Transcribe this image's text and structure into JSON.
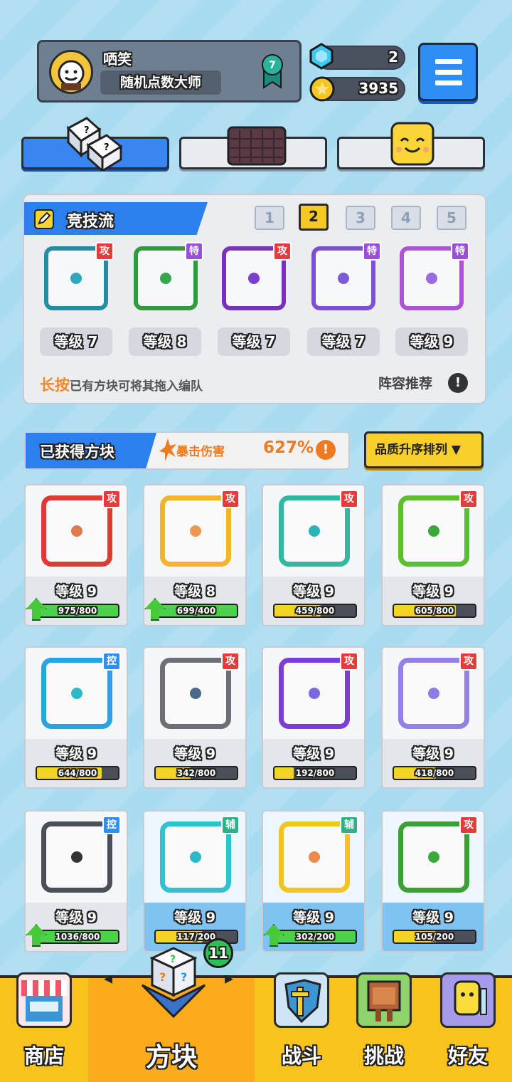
{
  "profile": {
    "nickname": "哂笑",
    "title": "随机点数大师",
    "rank": "7"
  },
  "currency": {
    "gems": "2",
    "coins": "3935"
  },
  "deck": {
    "title": "竞技流",
    "pages": [
      "1",
      "2",
      "3",
      "4",
      "5"
    ],
    "active_page": "2",
    "slots": [
      {
        "tag": "攻",
        "level": "等级 7",
        "color": "#1f8ea6",
        "dot": "#2da6be"
      },
      {
        "tag": "特",
        "level": "等级 8",
        "color": "#2e9b3d",
        "dot": "#34a84a"
      },
      {
        "tag": "攻",
        "level": "等级 7",
        "color": "#7b2fbf",
        "dot": "#7b3ed3"
      },
      {
        "tag": "特",
        "level": "等级 7",
        "color": "#7c4fd6",
        "dot": "#7a5cd6"
      },
      {
        "tag": "特",
        "level": "等级 9",
        "color": "#b04fd9",
        "dot": "#9a6be0"
      }
    ],
    "hint_highlight": "长按",
    "hint_text": "已有方块可将其拖入编队",
    "recommend": "阵容推荐"
  },
  "owned": {
    "label": "已获得方块",
    "crit_label": "暴击伤害",
    "crit_value": "627%",
    "sort": "品质升序排列 ▼"
  },
  "cards": [
    {
      "tag": "攻",
      "level": "等级 9",
      "progress": "975/800",
      "fill": 1.0,
      "upgrade": true,
      "color": "#e03a35",
      "dot": "#e07a4a"
    },
    {
      "tag": "攻",
      "level": "等级 8",
      "progress": "699/400",
      "fill": 1.0,
      "upgrade": true,
      "color": "#f4b52a",
      "dot": "#e99a50"
    },
    {
      "tag": "攻",
      "level": "等级 9",
      "progress": "459/800",
      "fill": 0.57,
      "upgrade": false,
      "color": "#2fb9a0",
      "dot": "#2db4b8"
    },
    {
      "tag": "攻",
      "level": "等级 9",
      "progress": "605/800",
      "fill": 0.76,
      "upgrade": false,
      "color": "#5cbf2e",
      "dot": "#3aa83a"
    },
    {
      "tag": "控",
      "level": "等级 9",
      "progress": "644/800",
      "fill": 0.8,
      "upgrade": false,
      "color": "#2aa3e0",
      "dot": "#2bb8c8"
    },
    {
      "tag": "攻",
      "level": "等级 9",
      "progress": "342/800",
      "fill": 0.43,
      "upgrade": false,
      "color": "#6c6f75",
      "dot": "#4a6a8a"
    },
    {
      "tag": "攻",
      "level": "等级 9",
      "progress": "192/800",
      "fill": 0.24,
      "upgrade": false,
      "color": "#7b3fd8",
      "dot": "#7a6ae0"
    },
    {
      "tag": "攻",
      "level": "等级 9",
      "progress": "418/800",
      "fill": 0.52,
      "upgrade": false,
      "color": "#9480e6",
      "dot": "#8c7ce6"
    },
    {
      "tag": "控",
      "level": "等级 9",
      "progress": "1036/800",
      "fill": 1.0,
      "upgrade": true,
      "color": "#4a4f59",
      "dot": "#333"
    },
    {
      "tag": "辅",
      "level": "等级 9",
      "progress": "117/200",
      "fill": 0.58,
      "upgrade": false,
      "color": "#2ec2d3",
      "dot": "#2db8c8"
    },
    {
      "tag": "辅",
      "level": "等级 9",
      "progress": "302/200",
      "fill": 1.0,
      "upgrade": true,
      "color": "#f2c51e",
      "dot": "#e98a4a"
    },
    {
      "tag": "攻",
      "level": "等级 9",
      "progress": "105/200",
      "fill": 0.52,
      "upgrade": false,
      "color": "#3aa233",
      "dot": "#3aa83a"
    }
  ],
  "nav": {
    "shop": "商店",
    "blocks": "方块",
    "battle": "战斗",
    "challenge": "挑战",
    "friends": "好友",
    "badge": "11"
  }
}
